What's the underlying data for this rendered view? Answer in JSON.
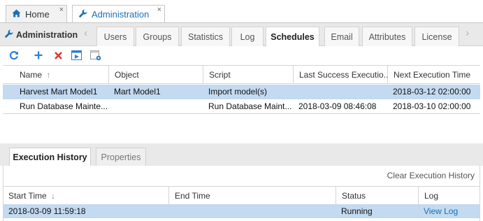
{
  "app_tabs": [
    {
      "label": "Home",
      "icon": "home-icon",
      "close": "×"
    },
    {
      "label": "Administration",
      "icon": "wrench-icon",
      "close": "×"
    }
  ],
  "section": {
    "title": "Administration",
    "tabs": [
      "Users",
      "Groups",
      "Statistics",
      "Log",
      "Schedules",
      "Email",
      "Attributes",
      "License"
    ],
    "active_tab": "Schedules"
  },
  "toolbar": {
    "icons": [
      "refresh-icon",
      "add-icon",
      "delete-icon",
      "run-icon",
      "schedule-settings-icon"
    ]
  },
  "schedules_grid": {
    "columns": [
      "Name",
      "Object",
      "Script",
      "Last Success Executio...",
      "Next Execution Time"
    ],
    "sort_indicator": "↑",
    "rows": [
      [
        "Harvest Mart Model1",
        "Mart Model1",
        "Import model(s)",
        "",
        "2018-03-12 02:00:00"
      ],
      [
        "Run Database Mainte...",
        "",
        "Run Database Maint...",
        "2018-03-09 08:46:08",
        "2018-03-10 02:00:00"
      ]
    ]
  },
  "bottom_panel": {
    "tabs": [
      "Execution History",
      "Properties"
    ],
    "clear_label": "Clear Execution History",
    "columns": [
      "Start Time",
      "End Time",
      "Status",
      "Log"
    ],
    "sort_indicator": "↓",
    "rows": [
      [
        "2018-03-09 11:59:18",
        "",
        "Running",
        "View Log"
      ]
    ]
  },
  "colors": {
    "accent": "#1b6fb5",
    "selected_row": "#c3daf0",
    "refresh": "#2f7fd0",
    "add": "#2f7fd0",
    "delete": "#d9352c"
  }
}
